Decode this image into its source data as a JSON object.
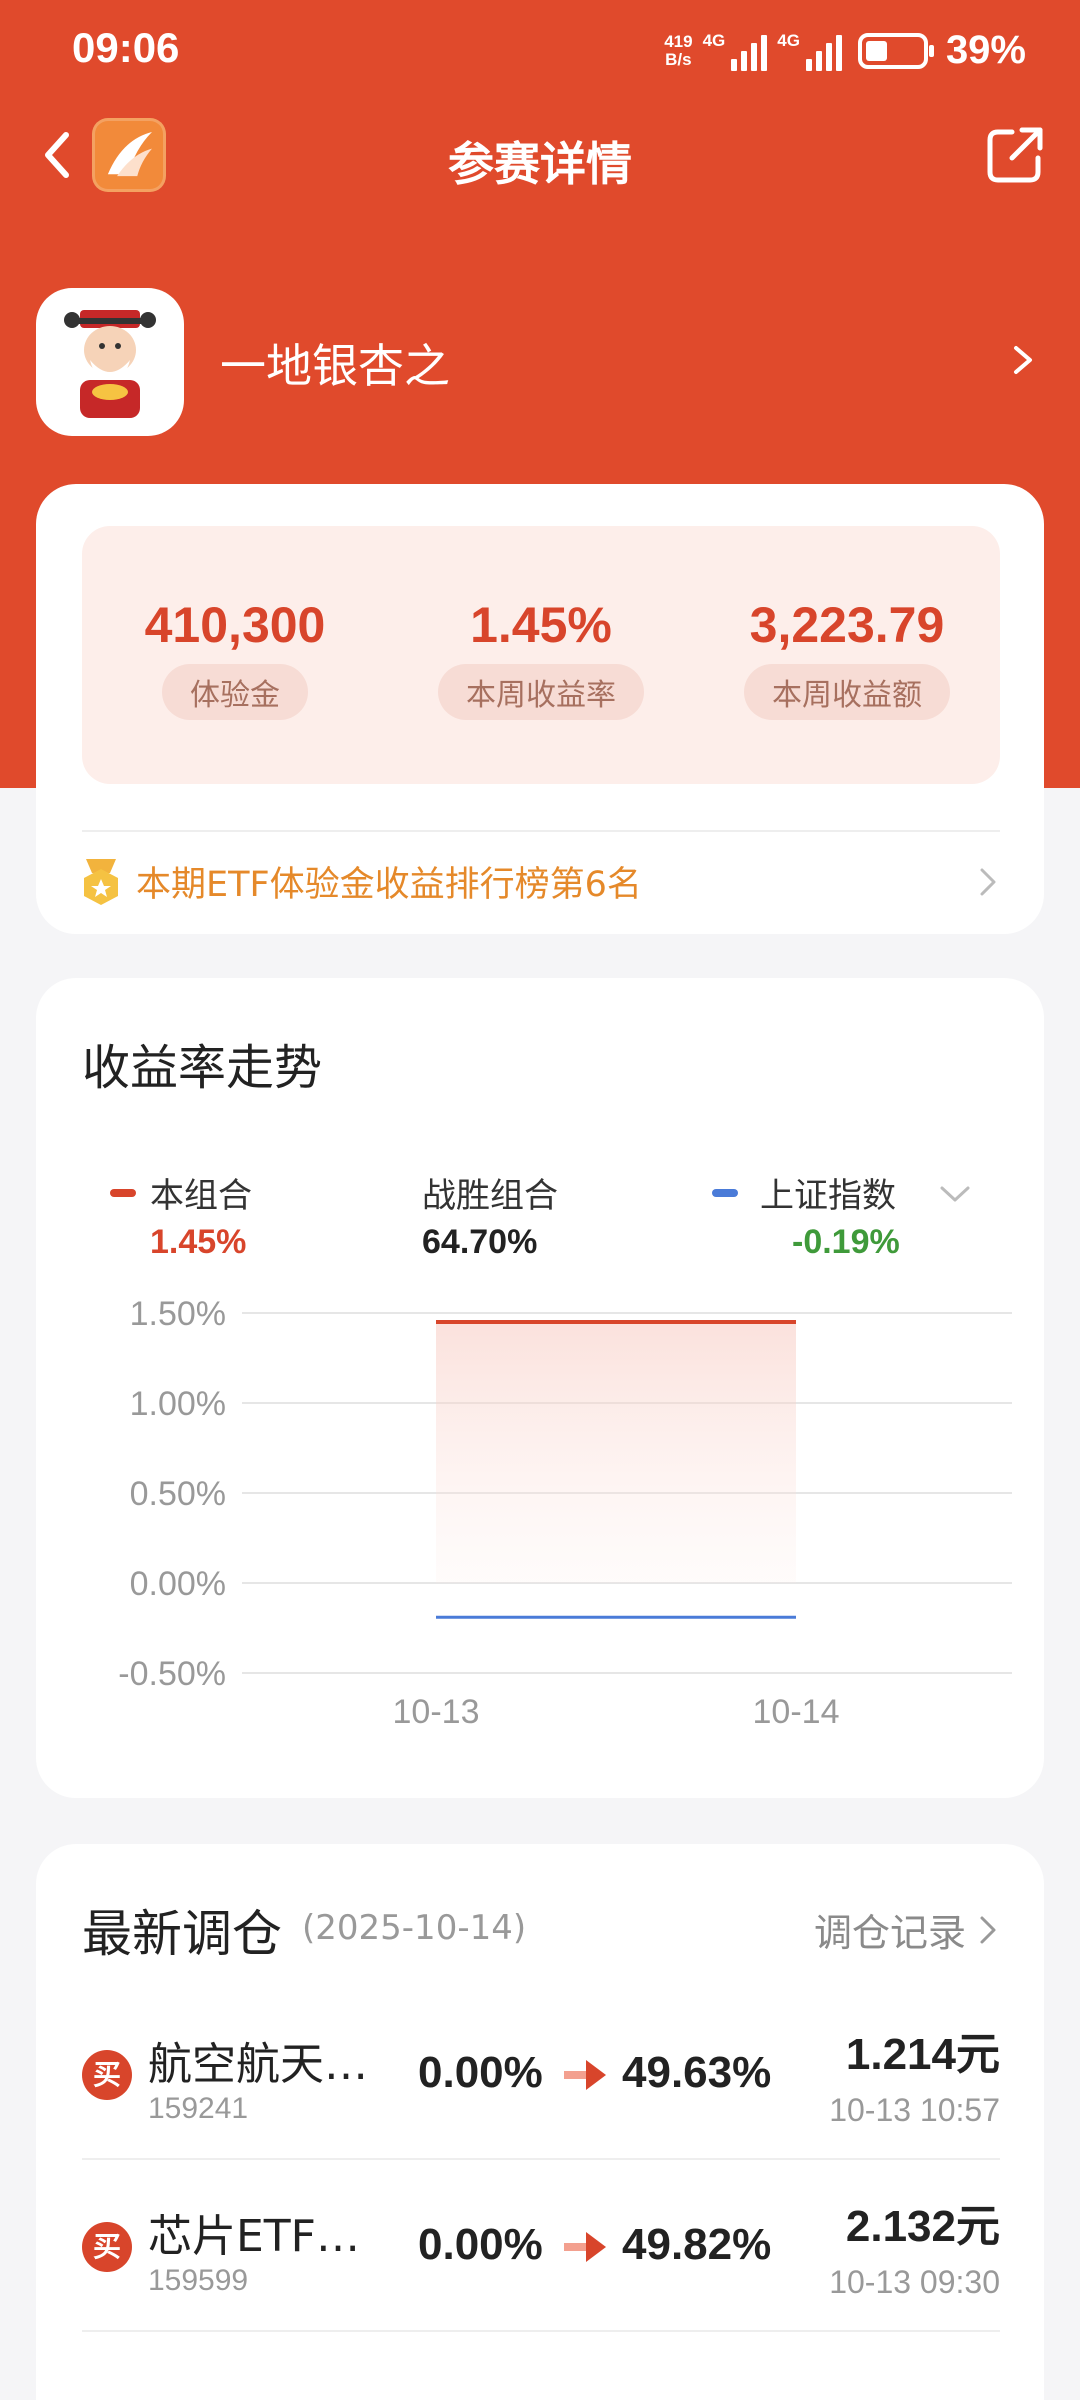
{
  "status_bar": {
    "time": "09:06",
    "net_speed_top": "419",
    "net_speed_bottom": "B/s",
    "signal1_label": "4G",
    "signal2_label": "4G",
    "battery_level": 0.39,
    "battery_pct": "39%"
  },
  "nav": {
    "title": "参赛详情",
    "back_icon": "chevron-left-icon",
    "share_icon": "share-icon"
  },
  "user": {
    "name": "一地银杏之"
  },
  "stats": [
    {
      "value": "410,300",
      "label": "体验金"
    },
    {
      "value": "1.45%",
      "label": "本周收益率"
    },
    {
      "value": "3,223.79",
      "label": "本周收益额"
    }
  ],
  "rank_text": "本期ETF体验金收益排行榜第6名",
  "trend": {
    "title": "收益率走势",
    "legend": [
      {
        "name": "本组合",
        "value": "1.45%",
        "color": "#d8452b",
        "value_color": "#d8452b"
      },
      {
        "name": "战胜组合",
        "value": "64.70%",
        "color": null,
        "value_color": "#222222"
      },
      {
        "name": "上证指数",
        "value": "-0.19%",
        "color": "#4a7bd8",
        "value_color": "#3f9a3a"
      }
    ]
  },
  "chart_data": {
    "type": "line",
    "title": "收益率走势",
    "xlabel": "",
    "ylabel": "",
    "categories": [
      "10-13",
      "10-14"
    ],
    "y_ticks": [
      "1.50%",
      "1.00%",
      "0.50%",
      "0.00%",
      "-0.50%"
    ],
    "ylim": [
      -0.5,
      1.5
    ],
    "grid": true,
    "series": [
      {
        "name": "本组合",
        "color": "#d8452b",
        "values": [
          1.45,
          1.45
        ]
      },
      {
        "name": "上证指数",
        "color": "#4a7bd8",
        "values": [
          -0.19,
          -0.19
        ]
      }
    ]
  },
  "rebalance": {
    "title": "最新调仓",
    "date": "(2025-10-14)",
    "link": "调仓记录",
    "rows": [
      {
        "badge": "买",
        "name": "航空航天…",
        "code": "159241",
        "from": "0.00%",
        "to": "49.63%",
        "price": "1.214元",
        "time": "10-13 10:57"
      },
      {
        "badge": "买",
        "name": "芯片ETF…",
        "code": "159599",
        "from": "0.00%",
        "to": "49.82%",
        "price": "2.132元",
        "time": "10-13 09:30"
      }
    ]
  }
}
